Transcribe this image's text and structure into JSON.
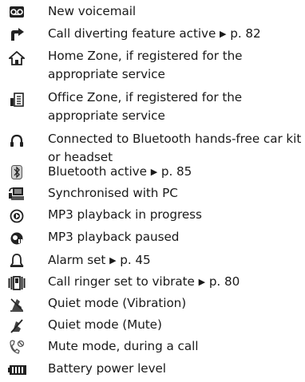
{
  "items": [
    {
      "icon": "voicemail-icon",
      "text": "New voicemail"
    },
    {
      "icon": "call-divert-icon",
      "text": "Call diverting feature active",
      "ref": "p. 82"
    },
    {
      "icon": "home-zone-icon",
      "text": "Home Zone, if registered for the appropriate service"
    },
    {
      "icon": "office-zone-icon",
      "text": "Office Zone, if registered for the appropriate service"
    },
    {
      "icon": "headset-icon",
      "text": "Connected to Bluetooth hands-free car kit or headset"
    },
    {
      "icon": "bluetooth-icon",
      "text": "Bluetooth active",
      "ref": "p. 85"
    },
    {
      "icon": "pc-sync-icon",
      "text": "Synchronised with PC"
    },
    {
      "icon": "mp3-play-icon",
      "text": "MP3 playback in progress"
    },
    {
      "icon": "mp3-pause-icon",
      "text": "MP3 playback paused"
    },
    {
      "icon": "alarm-icon",
      "text": "Alarm set",
      "ref": "p. 45"
    },
    {
      "icon": "vibrate-icon",
      "text": "Call ringer set to vibrate",
      "ref": "p. 80"
    },
    {
      "icon": "quiet-vibration-icon",
      "text": "Quiet mode (Vibration)"
    },
    {
      "icon": "quiet-mute-icon",
      "text": "Quiet mode (Mute)"
    },
    {
      "icon": "mic-mute-icon",
      "text": "Mute mode, during a call"
    },
    {
      "icon": "battery-icon",
      "text": "Battery power level"
    }
  ],
  "arrow_glyph": "▶"
}
